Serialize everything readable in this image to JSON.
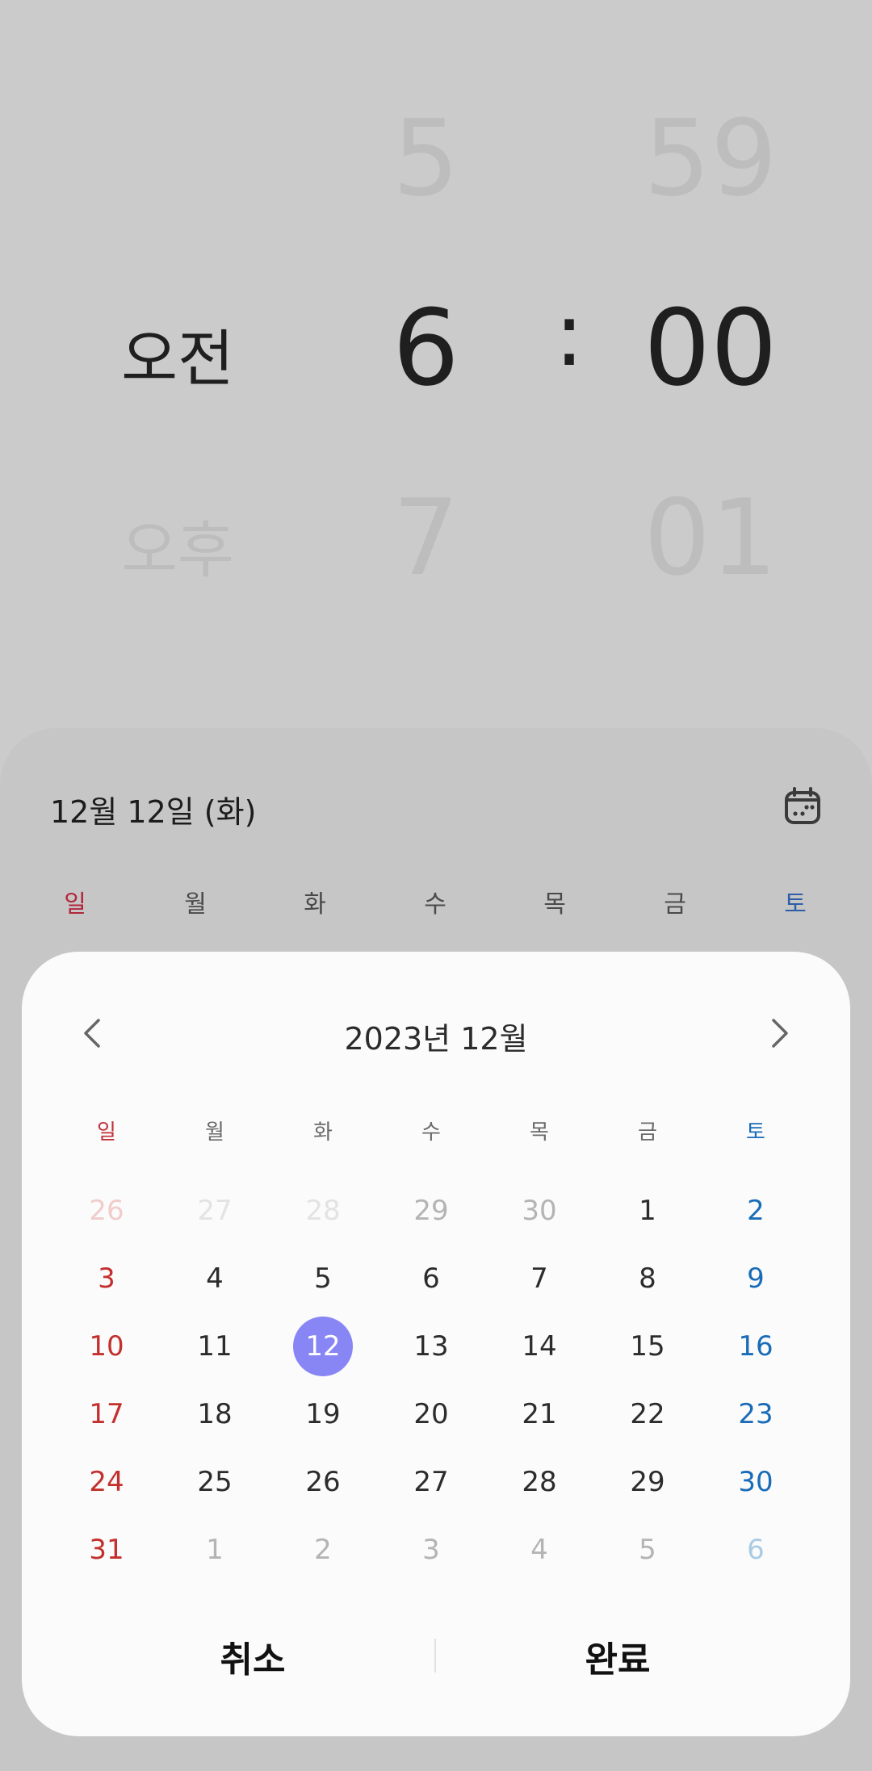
{
  "time_picker": {
    "ampm": {
      "prev": "",
      "current": "오전",
      "next": "오후"
    },
    "hour": {
      "prev": "5",
      "current": "6",
      "next": "7"
    },
    "separator": ":",
    "minute": {
      "prev": "59",
      "current": "00",
      "next": "01"
    }
  },
  "date_header": {
    "selected_date": "12월 12일 (화)",
    "calendar_icon": "calendar-icon"
  },
  "background_weekdays": [
    "일",
    "월",
    "화",
    "수",
    "목",
    "금",
    "토"
  ],
  "calendar": {
    "month_title": "2023년 12월",
    "prev_icon": "chevron-left-icon",
    "next_icon": "chevron-right-icon",
    "weekdays": [
      "일",
      "월",
      "화",
      "수",
      "목",
      "금",
      "토"
    ],
    "weeks": [
      [
        "26",
        "27",
        "28",
        "29",
        "30",
        "1",
        "2"
      ],
      [
        "3",
        "4",
        "5",
        "6",
        "7",
        "8",
        "9"
      ],
      [
        "10",
        "11",
        "12",
        "13",
        "14",
        "15",
        "16"
      ],
      [
        "17",
        "18",
        "19",
        "20",
        "21",
        "22",
        "23"
      ],
      [
        "24",
        "25",
        "26",
        "27",
        "28",
        "29",
        "30"
      ],
      [
        "31",
        "1",
        "2",
        "3",
        "4",
        "5",
        "6"
      ]
    ],
    "selected_day": "12",
    "accent_color": "#8886f5",
    "sunday_color": "#c3302d",
    "saturday_color": "#1a6cb8"
  },
  "buttons": {
    "cancel": "취소",
    "done": "완료"
  }
}
